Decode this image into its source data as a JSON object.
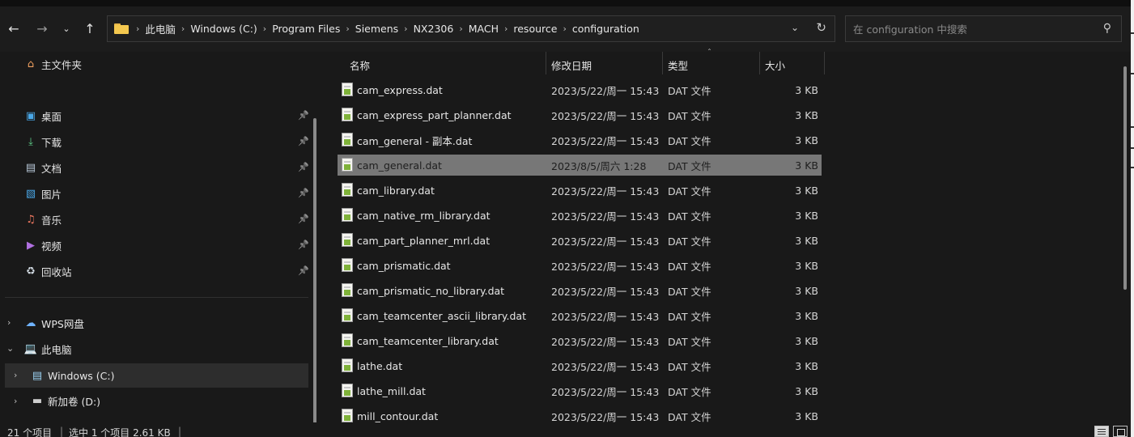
{
  "toolbar": {
    "back_icon": "arrow-left-icon",
    "forward_icon": "arrow-right-icon",
    "recent_icon": "chevron-down-icon",
    "up_icon": "arrow-up-icon"
  },
  "address": {
    "crumbs": [
      "此电脑",
      "Windows (C:)",
      "Program Files",
      "Siemens",
      "NX2306",
      "MACH",
      "resource",
      "configuration"
    ]
  },
  "search": {
    "placeholder": "在 configuration 中搜索"
  },
  "sidebar": {
    "home": "主文件夹",
    "quick": [
      {
        "label": "桌面",
        "icon": "desktop-icon"
      },
      {
        "label": "下载",
        "icon": "download-icon"
      },
      {
        "label": "文档",
        "icon": "document-icon"
      },
      {
        "label": "图片",
        "icon": "pictures-icon"
      },
      {
        "label": "音乐",
        "icon": "music-icon"
      },
      {
        "label": "视频",
        "icon": "video-icon"
      },
      {
        "label": "回收站",
        "icon": "recycle-bin-icon"
      }
    ],
    "wps": "WPS网盘",
    "pc": "此电脑",
    "drives": [
      "Windows (C:)",
      "新加卷 (D:)"
    ]
  },
  "columns": {
    "name": "名称",
    "date": "修改日期",
    "type": "类型",
    "size": "大小"
  },
  "files": [
    {
      "name": "cam_express.dat",
      "date": "2023/5/22/周一 15:43",
      "type": "DAT 文件",
      "size": "3 KB"
    },
    {
      "name": "cam_express_part_planner.dat",
      "date": "2023/5/22/周一 15:43",
      "type": "DAT 文件",
      "size": "3 KB"
    },
    {
      "name": "cam_general - 副本.dat",
      "date": "2023/5/22/周一 15:43",
      "type": "DAT 文件",
      "size": "3 KB"
    },
    {
      "name": "cam_general.dat",
      "date": "2023/8/5/周六 1:28",
      "type": "DAT 文件",
      "size": "3 KB",
      "selected": true
    },
    {
      "name": "cam_library.dat",
      "date": "2023/5/22/周一 15:43",
      "type": "DAT 文件",
      "size": "3 KB"
    },
    {
      "name": "cam_native_rm_library.dat",
      "date": "2023/5/22/周一 15:43",
      "type": "DAT 文件",
      "size": "3 KB"
    },
    {
      "name": "cam_part_planner_mrl.dat",
      "date": "2023/5/22/周一 15:43",
      "type": "DAT 文件",
      "size": "3 KB"
    },
    {
      "name": "cam_prismatic.dat",
      "date": "2023/5/22/周一 15:43",
      "type": "DAT 文件",
      "size": "3 KB"
    },
    {
      "name": "cam_prismatic_no_library.dat",
      "date": "2023/5/22/周一 15:43",
      "type": "DAT 文件",
      "size": "3 KB"
    },
    {
      "name": "cam_teamcenter_ascii_library.dat",
      "date": "2023/5/22/周一 15:43",
      "type": "DAT 文件",
      "size": "3 KB"
    },
    {
      "name": "cam_teamcenter_library.dat",
      "date": "2023/5/22/周一 15:43",
      "type": "DAT 文件",
      "size": "3 KB"
    },
    {
      "name": "lathe.dat",
      "date": "2023/5/22/周一 15:43",
      "type": "DAT 文件",
      "size": "3 KB"
    },
    {
      "name": "lathe_mill.dat",
      "date": "2023/5/22/周一 15:43",
      "type": "DAT 文件",
      "size": "3 KB"
    },
    {
      "name": "mill_contour.dat",
      "date": "2023/5/22/周一 15:43",
      "type": "DAT 文件",
      "size": "3 KB"
    }
  ],
  "status": {
    "count": "21 个项目",
    "selection": "选中 1 个项目  2.61 KB"
  },
  "colors": {
    "background": "#191919",
    "selected_row": "#777777",
    "folder": "#f4c84f"
  }
}
